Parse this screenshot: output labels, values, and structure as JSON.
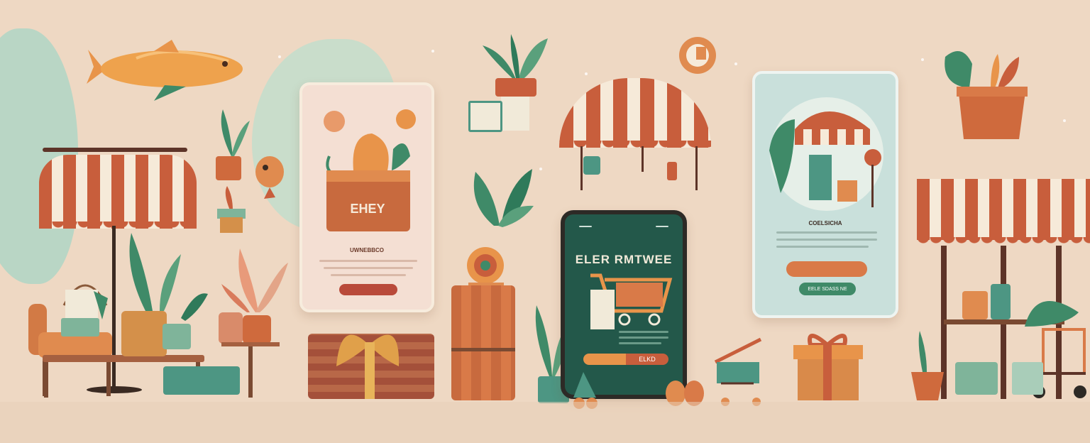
{
  "colors": {
    "background": "#eed8c3",
    "mint": "#a9cdb9",
    "terracotta": "#c85e3c",
    "cream": "#f7ecdd",
    "dark_green": "#23584a",
    "phone_frame": "#2d2a26",
    "leaf": "#3f8a68",
    "orange": "#e8944a"
  },
  "phone_left": {
    "basket_sign": "EHEY",
    "heading": "UWNEBBCO",
    "button_label": ""
  },
  "phone_center": {
    "headline": "ELER RMTWEE",
    "button_left": "",
    "button_right": "ELKD"
  },
  "phone_right": {
    "heading": "COELSICHA",
    "button_primary": "",
    "button_secondary": "EELE SDASS NE"
  },
  "icons": [
    "fish-illustration",
    "striped-awning-icon",
    "potted-plant-icon",
    "shopping-basket-icon",
    "shopping-cart-icon",
    "gift-box-icon",
    "market-stall-icon",
    "umbrella-icon",
    "flower-pot-icon"
  ]
}
